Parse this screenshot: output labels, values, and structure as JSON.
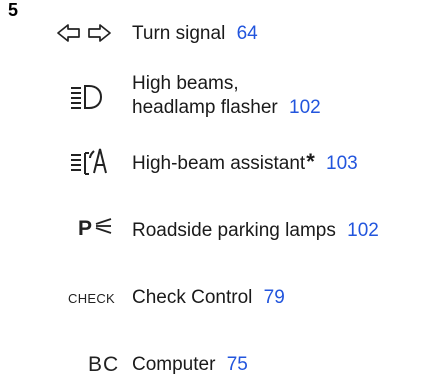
{
  "section_number": "5",
  "items": [
    {
      "icon": "turn-signal-icon",
      "label": "Turn signal",
      "page": "64"
    },
    {
      "icon": "high-beam-icon",
      "label_line1": "High beams,",
      "label_line2": "headlamp flasher",
      "page": "102"
    },
    {
      "icon": "high-beam-assistant-icon",
      "label": "High-beam assistant",
      "marker": "*",
      "page": "103"
    },
    {
      "icon": "parking-lamps-icon",
      "label": "Roadside parking lamps",
      "page": "102"
    },
    {
      "icon": "check-control-icon",
      "icon_text": "CHECK",
      "label": "Check Control",
      "page": "79"
    },
    {
      "icon": "computer-icon",
      "icon_text": "BC",
      "label": "Computer",
      "page": "75"
    }
  ]
}
